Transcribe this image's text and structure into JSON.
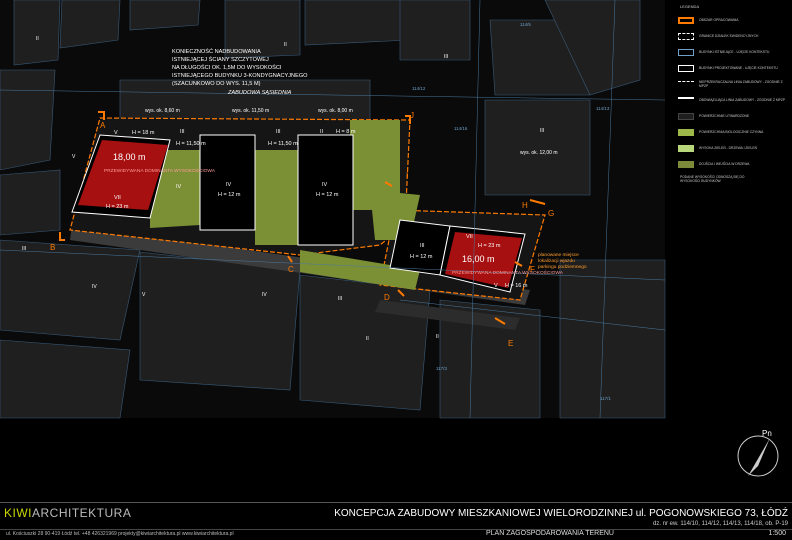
{
  "top_note": [
    "KONIECZNOŚĆ NADBUDOWANIA",
    "ISTNIEJĄCEJ ŚCIANY SZCZYTOWEJ",
    "NA DŁUGOŚCI OK. 1,5M DO WYSOKOŚCI",
    "ISTNIEJĄCEGO BUDYNKU 3-KONDYGNACYJNEGO",
    "(SZACUNKOWO DO WYS. 11,5 M)"
  ],
  "neighbour_label": "ZABUDOWA SĄSIEDNIA",
  "neighbour_heights": [
    "wys. ok. 8,60 m",
    "wys. ok. 11,50 m",
    "wys. ok. 8,00 m",
    "wys. ok. 12,00 m"
  ],
  "highlight_note": [
    "planowane miejsce",
    "lokalizacji wjazdu",
    "parkingu podziemnego"
  ],
  "buildings": [
    {
      "storeys": "V",
      "height": "H = 18 m"
    },
    {
      "storeys": "III",
      "height": "H = 11,50 m"
    },
    {
      "storeys": "III",
      "height": "H = 11,50 m"
    },
    {
      "storeys": "II",
      "height": "H = 8 m"
    },
    {
      "storeys": "IV",
      "height": "H = 12 m"
    },
    {
      "storeys": "IV",
      "height": "H = 12 m"
    },
    {
      "storeys": "IV",
      "height": "H = 12 m"
    },
    {
      "storeys": "VII",
      "height": "H = 23 m"
    },
    {
      "storeys": "III",
      "height": "H = 12 m"
    },
    {
      "storeys": "VII",
      "height": "H = 23 m"
    },
    {
      "storeys": "V",
      "height": "H = 16 m"
    }
  ],
  "dominant_labels": [
    {
      "height": "18,00 m",
      "text": "PRZEWIDYWANA DOMINANTA WYSOKOŚCIOWA"
    },
    {
      "height": "16,00 m",
      "text": "PRZEWIDYWANA DOMINANTA WYSOKOŚCIOWA"
    }
  ],
  "section_markers": [
    "A",
    "B",
    "C",
    "D",
    "E",
    "F",
    "G",
    "H",
    "I",
    "J"
  ],
  "existing_storeys": [
    "II",
    "II",
    "III",
    "IV",
    "IV",
    "V",
    "V",
    "III",
    "III",
    "II",
    "III",
    "II"
  ],
  "parcel_numbers": [
    "114/12",
    "114/13",
    "114/16",
    "117/3",
    "117/1",
    "114/5"
  ],
  "north_label": "Pn",
  "legend": {
    "title": "LEGENDA",
    "items": [
      {
        "text": "OBSZAR OPRACOWANIA",
        "color": "#ff7a00"
      },
      {
        "text": "GRANICE DZIAŁEK EWIDENCYJNYCH",
        "color": "#ffffff"
      },
      {
        "text": "BUDYNKI ISTNIEJĄCE - UJĘCIE KONTEKSTU",
        "color": "#6ea0c8"
      },
      {
        "text": "BUDYNKI PROJEKTOWANE - UJĘCIE KONTEKSTU",
        "color": "#ffffff"
      },
      {
        "text": "NIEPRZEKRACZALNA LINIA ZABUDOWY - ZGODNIE Z MPZP",
        "color": "#ffffff"
      },
      {
        "text": "OBOWIĄZUJĄCA LINIA ZABUDOWY - ZGODNIE Z MPZP",
        "color": "#ffffff"
      },
      {
        "text": "POWIERZCHNIE UTWARDZONE",
        "color": "#1e1e1e"
      },
      {
        "text": "POWIERZCHNIA BIOLOGICZNIE CZYNNA",
        "color": "#9fb84a"
      },
      {
        "text": "WYSOKA ZIELEŃ - DRZEWA I ZIELEŃ",
        "color": "#b8d67a"
      },
      {
        "text": "DOJŚCIA I WEJŚCIA W DRZEWA",
        "color": "#7c8a3a"
      }
    ],
    "note": "PODANE WYSOKOŚCI ODNOSZĄ SIĘ DO WYSOKOŚCI BUDYNKÓW"
  },
  "title_block": {
    "logo_kiwi": "KIWI",
    "logo_arch": "ARCHITEKTURA",
    "contact": "ul. Kościuszki 28 90-419 Łódź   tel. +48 426321969   projekty@kiwiarchitektura.pl   www.kiwiarchitektura.pl",
    "project": "KONCEPCJA ZABUDOWY MIESZKANIOWEJ WIELORODZINNEJ  ul. POGONOWSKIEGO 73, ŁÓDŹ",
    "parcels": "dz. nr ew. 114/10, 114/12, 114/13, 114/18, ob. P-19",
    "sheet": "PLAN ZAGOSPODAROWANIA TERENU",
    "scale": "1:500"
  }
}
